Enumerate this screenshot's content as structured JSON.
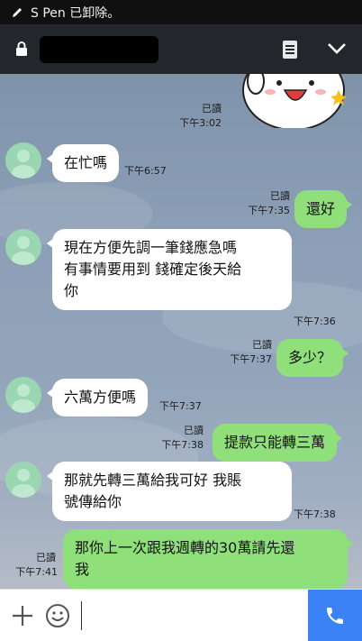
{
  "status_bar": {
    "notification": "S Pen 已卸除。"
  },
  "header": {
    "chat_title": "(redacted)"
  },
  "messages": [
    {
      "read": "已讀",
      "time": "下午3:02"
    },
    {
      "text": "在忙嗎",
      "time": "下午6:57"
    },
    {
      "text": "還好",
      "read": "已讀",
      "time": "下午7:35"
    },
    {
      "lines": [
        "現在方便先調一筆錢應急嗎",
        "有事情要用到  錢確定後天給",
        "你"
      ],
      "time": "下午7:36"
    },
    {
      "text": "多少？",
      "read": "已讀",
      "time": "下午7:37"
    },
    {
      "text": "六萬方便嗎",
      "time": "下午7:37"
    },
    {
      "text": "提款只能轉三萬",
      "read": "已讀",
      "time": "下午7:38"
    },
    {
      "lines": [
        "那就先轉三萬給我可好 我賬",
        "號傳給你"
      ],
      "time": "下午7:38"
    },
    {
      "lines": [
        "那你上一次跟我週轉的30萬請先還",
        "我"
      ],
      "read": "已讀",
      "time": "下午7:41"
    }
  ],
  "input": {
    "placeholder": ""
  },
  "icons": {
    "pen": "pen-icon",
    "lock": "lock-icon",
    "memo": "note-icon",
    "chevron": "chevron-down-icon",
    "plus": "plus-icon",
    "emoji": "emoji-icon",
    "call": "phone-icon"
  },
  "colors": {
    "outgoing_bubble": "#8fe07a",
    "incoming_bubble": "#ffffff",
    "call_button": "#3b82f6",
    "header": "#23262b"
  }
}
